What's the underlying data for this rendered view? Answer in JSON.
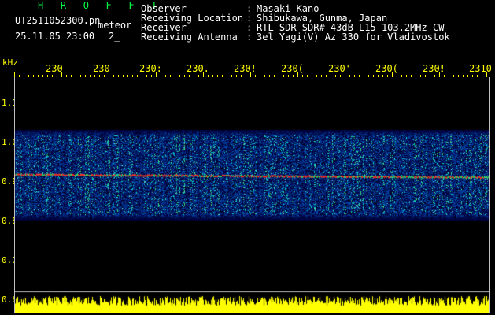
{
  "header": {
    "brand": "H R O F F T",
    "filename": "UT2511052300.pn",
    "meteor_label": "meteor",
    "datetime": "25.11.05 23:00",
    "counter": "2_"
  },
  "info": [
    {
      "label": "Observer",
      "value": "Masaki Kano"
    },
    {
      "label": "Receiving Location",
      "value": "Shibukawa, Gunma, Japan"
    },
    {
      "label": "Receiver",
      "value": "RTL-SDR SDR# 43dB L15 103.2MHz CW"
    },
    {
      "label": "Receiving Antenna",
      "value": "3el Yagi(V) Az 330 for Vladivostok"
    }
  ],
  "axes": {
    "unit": "kHz",
    "y_ticks": [
      "1.1",
      "1.0",
      "0.9",
      "0.8",
      "0.7",
      "0.6"
    ],
    "x_ticks": [
      "230",
      "230",
      "230:",
      "230.",
      "230!",
      "230(",
      "230'",
      "230(",
      "230!",
      "2310"
    ]
  },
  "chart_data": {
    "type": "heatmap",
    "title": "",
    "xlabel": "",
    "ylabel": "kHz",
    "y_ticks": [
      1.1,
      1.0,
      0.9,
      0.8,
      0.7,
      0.6
    ],
    "ylim": [
      0.6,
      1.15
    ],
    "signal_band": [
      0.79,
      1.02
    ],
    "carrier_line": {
      "start_khz": 0.905,
      "end_khz": 0.898
    },
    "colors": {
      "band": "#1040c0",
      "carrier": "#ff3020",
      "bottom": "#ffff00",
      "grid": "#c0c0c0",
      "ticks": "#ffff00"
    }
  }
}
